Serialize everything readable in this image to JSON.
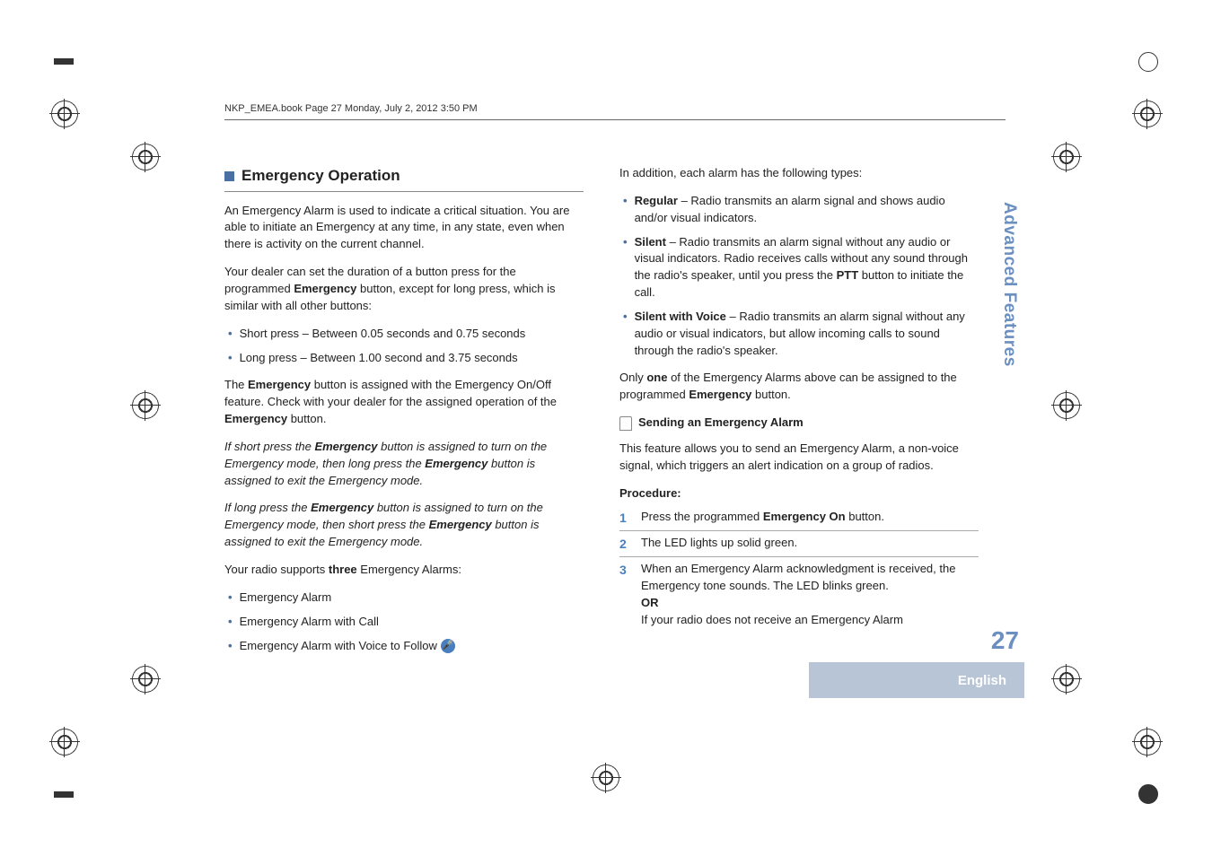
{
  "header": "NKP_EMEA.book  Page 27  Monday, July 2, 2012  3:50 PM",
  "side_tab": "Advanced Features",
  "page_number": "27",
  "language": "English",
  "left": {
    "heading": "Emergency Operation",
    "p1": "An Emergency Alarm is used to indicate a critical situation. You are able to initiate an Emergency at any time, in any state, even when there is activity on the current channel.",
    "p2a": "Your dealer can set the duration of a button press for the programmed ",
    "p2b": "Emergency",
    "p2c": " button, except for long press, which is similar with all other buttons:",
    "b1": "Short press – Between 0.05 seconds and 0.75 seconds",
    "b2": "Long press – Between 1.00 second and 3.75 seconds",
    "p3a": "The ",
    "p3b": "Emergency",
    "p3c": " button is assigned with the Emergency On/Off feature. Check with your dealer for the assigned operation of the ",
    "p3d": "Emergency",
    "p3e": " button.",
    "p4a": "If short press the ",
    "p4b": "Emergency",
    "p4c": " button is assigned to turn on the Emergency mode, then long press the ",
    "p4d": "Emergency",
    "p4e": " button is assigned to exit the Emergency mode.",
    "p5a": "If long press the ",
    "p5b": "Emergency",
    "p5c": " button is assigned to turn on the Emergency mode, then short press the ",
    "p5d": "Emergency",
    "p5e": " button is assigned to exit the Emergency mode.",
    "p6a": "Your radio supports ",
    "p6b": "three",
    "p6c": " Emergency Alarms:",
    "b3": "Emergency Alarm",
    "b4": "Emergency Alarm with Call",
    "b5": "Emergency Alarm with Voice to Follow"
  },
  "right": {
    "p1": "In addition, each alarm has the following types:",
    "b1a": "Regular",
    "b1b": " – Radio transmits an alarm signal and shows audio and/or visual indicators.",
    "b2a": "Silent",
    "b2b": " – Radio transmits an alarm signal without any audio or visual indicators. Radio receives calls without any sound through the radio's speaker, until you press the ",
    "b2c": "PTT",
    "b2d": " button to initiate the call.",
    "b3a": "Silent with Voice",
    "b3b": " – Radio transmits an alarm signal without any audio or visual indicators, but allow incoming calls to sound through the radio's speaker.",
    "p2a": "Only ",
    "p2b": "one",
    "p2c": " of the Emergency Alarms above can be assigned to the programmed ",
    "p2d": "Emergency",
    "p2e": " button.",
    "sub": "Sending an Emergency Alarm",
    "p3": "This feature allows you to send an Emergency Alarm, a non-voice signal, which triggers an alert indication on a group of radios.",
    "proc": "Procedure:",
    "s1a": "Press the programmed ",
    "s1b": "Emergency On",
    "s1c": " button.",
    "s2": "The LED lights up solid green.",
    "s3a": "When an Emergency Alarm acknowledgment is received, the Emergency tone sounds. The LED blinks green.",
    "s3b": "OR",
    "s3c": "If your radio does not receive an Emergency Alarm"
  }
}
